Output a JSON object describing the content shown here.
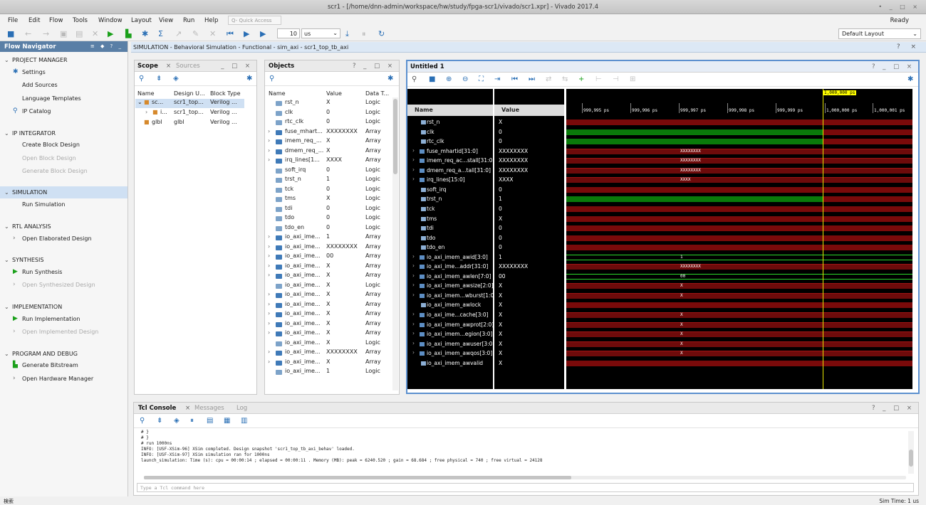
{
  "window_title": "scr1 - [/home/dnn-admin/workspace/hw/study/fpga-scr1/vivado/scr1.xpr] - Vivado 2017.4",
  "window_buttons": "• _ □ ×",
  "menu": [
    "File",
    "Edit",
    "Flow",
    "Tools",
    "Window",
    "Layout",
    "View",
    "Run",
    "Help"
  ],
  "quick_access": "Q- Quick Access",
  "ready": "Ready",
  "toolbar": {
    "run_length": "10",
    "run_unit": "us",
    "layout": "Default Layout"
  },
  "flow_nav": {
    "title": "Flow Navigator",
    "header_icons": "≡ ◆ ? _",
    "sections": [
      {
        "label": "PROJECT MANAGER",
        "items": [
          {
            "label": "Settings",
            "icon": "gear-icon"
          },
          {
            "label": "Add Sources"
          },
          {
            "label": "Language Templates"
          },
          {
            "label": "IP Catalog",
            "icon": "ip-icon"
          }
        ]
      },
      {
        "label": "IP INTEGRATOR",
        "items": [
          {
            "label": "Create Block Design"
          },
          {
            "label": "Open Block Design",
            "disabled": true
          },
          {
            "label": "Generate Block Design",
            "disabled": true
          }
        ]
      },
      {
        "label": "SIMULATION",
        "items": [
          {
            "label": "Run Simulation"
          }
        ]
      },
      {
        "label": "RTL ANALYSIS",
        "items": [
          {
            "label": "Open Elaborated Design"
          }
        ]
      },
      {
        "label": "SYNTHESIS",
        "items": [
          {
            "label": "Run Synthesis",
            "icon": "play-icon"
          },
          {
            "label": "Open Synthesized Design",
            "disabled": true
          }
        ]
      },
      {
        "label": "IMPLEMENTATION",
        "items": [
          {
            "label": "Run Implementation",
            "icon": "play-icon"
          },
          {
            "label": "Open Implemented Design",
            "disabled": true
          }
        ]
      },
      {
        "label": "PROGRAM AND DEBUG",
        "items": [
          {
            "label": "Generate Bitstream",
            "icon": "bitstream-icon"
          },
          {
            "label": "Open Hardware Manager"
          }
        ]
      }
    ]
  },
  "sim_header": "SIMULATION - Behavioral Simulation - Functional - sim_axi - scr1_top_tb_axi",
  "sim_header_right": "? ×",
  "scope": {
    "tabs": [
      "Scope",
      "Sources"
    ],
    "ctl": "_ □ ×",
    "columns": [
      "Name",
      "Design U...",
      "Block Type"
    ],
    "rows": [
      {
        "name": "sc...",
        "unit": "scr1_top...",
        "type": "Verilog ..."
      },
      {
        "name": "i...",
        "unit": "scr1_top...",
        "type": "Verilog ..."
      },
      {
        "name": "glbl",
        "unit": "glbl",
        "type": "Verilog ..."
      }
    ]
  },
  "objects": {
    "title": "Objects",
    "ctl": "? _ □ ×",
    "columns": [
      "Name",
      "Value",
      "Data T..."
    ],
    "rows": [
      {
        "name": "rst_n",
        "value": "X",
        "type": "Logic"
      },
      {
        "name": "clk",
        "value": "0",
        "type": "Logic"
      },
      {
        "name": "rtc_clk",
        "value": "0",
        "type": "Logic"
      },
      {
        "name": "fuse_mhart...",
        "value": "XXXXXXXX",
        "type": "Array"
      },
      {
        "name": "imem_req_...",
        "value": "X",
        "type": "Array"
      },
      {
        "name": "dmem_req_...",
        "value": "X",
        "type": "Array"
      },
      {
        "name": "irq_lines[1...",
        "value": "XXXX",
        "type": "Array"
      },
      {
        "name": "soft_irq",
        "value": "0",
        "type": "Logic"
      },
      {
        "name": "trst_n",
        "value": "1",
        "type": "Logic"
      },
      {
        "name": "tck",
        "value": "0",
        "type": "Logic"
      },
      {
        "name": "tms",
        "value": "X",
        "type": "Logic"
      },
      {
        "name": "tdi",
        "value": "0",
        "type": "Logic"
      },
      {
        "name": "tdo",
        "value": "0",
        "type": "Logic"
      },
      {
        "name": "tdo_en",
        "value": "0",
        "type": "Logic"
      },
      {
        "name": "io_axi_ime...",
        "value": "1",
        "type": "Array"
      },
      {
        "name": "io_axi_ime...",
        "value": "XXXXXXXX",
        "type": "Array"
      },
      {
        "name": "io_axi_ime...",
        "value": "00",
        "type": "Array"
      },
      {
        "name": "io_axi_ime...",
        "value": "X",
        "type": "Array"
      },
      {
        "name": "io_axi_ime...",
        "value": "X",
        "type": "Array"
      },
      {
        "name": "io_axi_ime...",
        "value": "X",
        "type": "Logic"
      },
      {
        "name": "io_axi_ime...",
        "value": "X",
        "type": "Array"
      },
      {
        "name": "io_axi_ime...",
        "value": "X",
        "type": "Array"
      },
      {
        "name": "io_axi_ime...",
        "value": "X",
        "type": "Array"
      },
      {
        "name": "io_axi_ime...",
        "value": "X",
        "type": "Array"
      },
      {
        "name": "io_axi_ime...",
        "value": "X",
        "type": "Array"
      },
      {
        "name": "io_axi_ime...",
        "value": "X",
        "type": "Logic"
      },
      {
        "name": "io_axi_ime...",
        "value": "XXXXXXXX",
        "type": "Array"
      },
      {
        "name": "io_axi_ime...",
        "value": "X",
        "type": "Array"
      },
      {
        "name": "io_axi_ime...",
        "value": "1",
        "type": "Logic"
      }
    ]
  },
  "wave": {
    "title": "Untitled 1",
    "ctl": "? _ □ ×",
    "name_header": "Name",
    "value_header": "Value",
    "cursor_label": "1,000,000 ps",
    "ticks": [
      "999,995 ps",
      "999,996 ps",
      "999,997 ps",
      "999,998 ps",
      "999,999 ps",
      "1,000,000 ps",
      "1,000,001 ps"
    ],
    "signals": [
      {
        "name": "rst_n",
        "value": "X",
        "kind": "red"
      },
      {
        "name": "clk",
        "value": "0",
        "kind": "green"
      },
      {
        "name": "rtc_clk",
        "value": "0",
        "kind": "green"
      },
      {
        "name": "fuse_mhartid[31:0]",
        "value": "XXXXXXXX",
        "kind": "bus",
        "label": "XXXXXXXX"
      },
      {
        "name": "imem_req_ac...stall[31:0]",
        "value": "XXXXXXXX",
        "kind": "bus",
        "label": "XXXXXXXX"
      },
      {
        "name": "dmem_req_a...tall[31:0]",
        "value": "XXXXXXXX",
        "kind": "bus",
        "label": "XXXXXXXX"
      },
      {
        "name": "irq_lines[15:0]",
        "value": "XXXX",
        "kind": "bus",
        "label": "XXXX"
      },
      {
        "name": "soft_irq",
        "value": "0",
        "kind": "red"
      },
      {
        "name": "trst_n",
        "value": "1",
        "kind": "green"
      },
      {
        "name": "tck",
        "value": "0",
        "kind": "red"
      },
      {
        "name": "tms",
        "value": "X",
        "kind": "red"
      },
      {
        "name": "tdi",
        "value": "0",
        "kind": "red"
      },
      {
        "name": "tdo",
        "value": "0",
        "kind": "red"
      },
      {
        "name": "tdo_en",
        "value": "0",
        "kind": "red"
      },
      {
        "name": "io_axi_imem_awid[3:0]",
        "value": "1",
        "kind": "busg",
        "label": "1"
      },
      {
        "name": "io_axi_ime...addr[31:0]",
        "value": "XXXXXXXX",
        "kind": "bus",
        "label": "XXXXXXXX"
      },
      {
        "name": "io_axi_imem_awlen[7:0]",
        "value": "00",
        "kind": "busg",
        "label": "00"
      },
      {
        "name": "io_axi_imem_awsize[2:0]",
        "value": "X",
        "kind": "bus",
        "label": "X"
      },
      {
        "name": "io_axi_imem...wburst[1:0]",
        "value": "X",
        "kind": "bus",
        "label": "X"
      },
      {
        "name": "io_axi_imem_awlock",
        "value": "X",
        "kind": "red"
      },
      {
        "name": "io_axi_ime...cache[3:0]",
        "value": "X",
        "kind": "bus",
        "label": "X"
      },
      {
        "name": "io_axi_imem_awprot[2:0]",
        "value": "X",
        "kind": "bus",
        "label": "X"
      },
      {
        "name": "io_axi_imem...egion[3:0]",
        "value": "X",
        "kind": "bus",
        "label": "X"
      },
      {
        "name": "io_axi_imem_awuser[3:0]",
        "value": "X",
        "kind": "bus",
        "label": "X"
      },
      {
        "name": "io_axi_imem_awqos[3:0]",
        "value": "X",
        "kind": "bus",
        "label": "X"
      },
      {
        "name": "io_axi_imem_awvalid",
        "value": "X",
        "kind": "red"
      }
    ]
  },
  "tcl": {
    "tabs": [
      "Tcl Console",
      "Messages",
      "Log"
    ],
    "ctl": "? _ □ ×",
    "lines": [
      "# }",
      "# }",
      "# run 1000ns",
      "INFO: [USF-XSim-96] XSim completed. Design snapshot 'scr1_top_tb_axi_behav' loaded.",
      "INFO: [USF-XSim-97] XSim simulation ran for 1000ns",
      "launch_simulation: Time (s): cpu = 00:00:14 ; elapsed = 00:00:11 . Memory (MB): peak = 6240.520 ; gain = 68.684 ; free physical = 740 ; free virtual = 24128"
    ],
    "placeholder": "Type a Tcl command here"
  },
  "status_left": "検索",
  "status_right": "Sim Time: 1 us"
}
